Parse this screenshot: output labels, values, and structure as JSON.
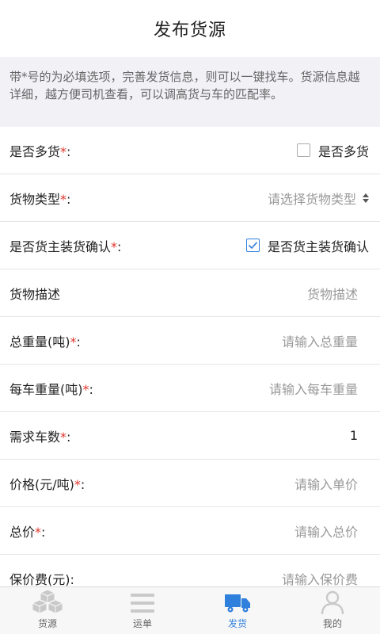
{
  "header": {
    "title": "发布货源"
  },
  "notice": {
    "text": "带*号的为必填选项，完善发货信息，则可以一键找车。货源信息越详细，越方便司机查看，可以调高货与车的匹配率。"
  },
  "form": {
    "rows": [
      {
        "label": "是否多货",
        "required": "*",
        "suffix": ":",
        "value": "是否多货",
        "type": "checkbox",
        "checked": false
      },
      {
        "label": "货物类型",
        "required": "*",
        "suffix": ":",
        "value": "请选择货物类型",
        "type": "select"
      },
      {
        "label": "是否货主装货确认",
        "required": "*",
        "suffix": ":",
        "value": "是否货主装货确认",
        "type": "checkbox",
        "checked": true
      },
      {
        "label": "货物描述",
        "required": "",
        "suffix": "",
        "value": "货物描述",
        "type": "input"
      },
      {
        "label": "总重量(吨)",
        "required": "*",
        "suffix": ":",
        "value": "请输入总重量",
        "type": "input"
      },
      {
        "label": "每车重量(吨)",
        "required": "*",
        "suffix": ":",
        "value": "请输入每车重量",
        "type": "input"
      },
      {
        "label": "需求车数",
        "required": "*",
        "suffix": ":",
        "value": "1",
        "type": "input"
      },
      {
        "label": "价格(元/吨)",
        "required": "*",
        "suffix": ":",
        "value": "请输入单价",
        "type": "input"
      },
      {
        "label": "总价",
        "required": "*",
        "suffix": ":",
        "value": "请输入总价",
        "type": "input"
      },
      {
        "label": "保价费(元)",
        "required": "",
        "suffix": ":",
        "value": "请输入保价费",
        "type": "input"
      }
    ]
  },
  "tabbar": {
    "items": [
      {
        "label": "货源",
        "icon": "boxes-icon",
        "active": false
      },
      {
        "label": "运单",
        "icon": "list-icon",
        "active": false
      },
      {
        "label": "发货",
        "icon": "truck-icon",
        "active": true
      },
      {
        "label": "我的",
        "icon": "user-icon",
        "active": false
      }
    ]
  },
  "colors": {
    "accent": "#2f7fdc",
    "required": "#e0352c",
    "placeholder": "#999999"
  }
}
